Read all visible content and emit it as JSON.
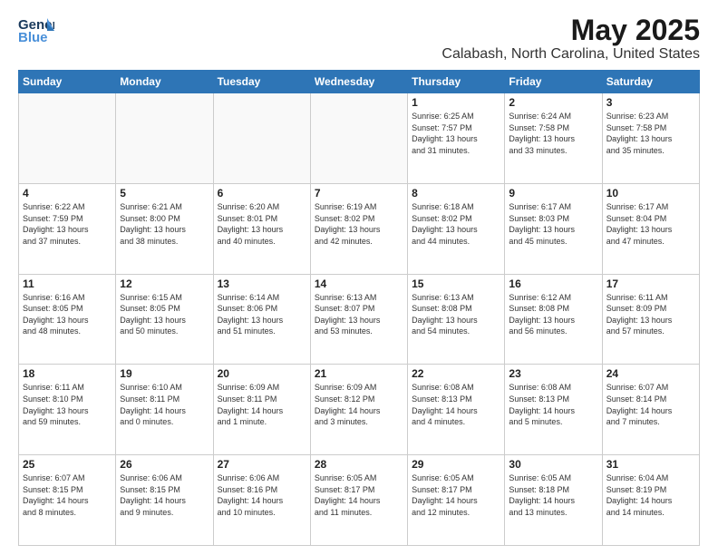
{
  "logo": {
    "line1": "General",
    "line2": "Blue"
  },
  "title": "May 2025",
  "subtitle": "Calabash, North Carolina, United States",
  "weekdays": [
    "Sunday",
    "Monday",
    "Tuesday",
    "Wednesday",
    "Thursday",
    "Friday",
    "Saturday"
  ],
  "weeks": [
    [
      {
        "day": "",
        "info": ""
      },
      {
        "day": "",
        "info": ""
      },
      {
        "day": "",
        "info": ""
      },
      {
        "day": "",
        "info": ""
      },
      {
        "day": "1",
        "info": "Sunrise: 6:25 AM\nSunset: 7:57 PM\nDaylight: 13 hours\nand 31 minutes."
      },
      {
        "day": "2",
        "info": "Sunrise: 6:24 AM\nSunset: 7:58 PM\nDaylight: 13 hours\nand 33 minutes."
      },
      {
        "day": "3",
        "info": "Sunrise: 6:23 AM\nSunset: 7:58 PM\nDaylight: 13 hours\nand 35 minutes."
      }
    ],
    [
      {
        "day": "4",
        "info": "Sunrise: 6:22 AM\nSunset: 7:59 PM\nDaylight: 13 hours\nand 37 minutes."
      },
      {
        "day": "5",
        "info": "Sunrise: 6:21 AM\nSunset: 8:00 PM\nDaylight: 13 hours\nand 38 minutes."
      },
      {
        "day": "6",
        "info": "Sunrise: 6:20 AM\nSunset: 8:01 PM\nDaylight: 13 hours\nand 40 minutes."
      },
      {
        "day": "7",
        "info": "Sunrise: 6:19 AM\nSunset: 8:02 PM\nDaylight: 13 hours\nand 42 minutes."
      },
      {
        "day": "8",
        "info": "Sunrise: 6:18 AM\nSunset: 8:02 PM\nDaylight: 13 hours\nand 44 minutes."
      },
      {
        "day": "9",
        "info": "Sunrise: 6:17 AM\nSunset: 8:03 PM\nDaylight: 13 hours\nand 45 minutes."
      },
      {
        "day": "10",
        "info": "Sunrise: 6:17 AM\nSunset: 8:04 PM\nDaylight: 13 hours\nand 47 minutes."
      }
    ],
    [
      {
        "day": "11",
        "info": "Sunrise: 6:16 AM\nSunset: 8:05 PM\nDaylight: 13 hours\nand 48 minutes."
      },
      {
        "day": "12",
        "info": "Sunrise: 6:15 AM\nSunset: 8:05 PM\nDaylight: 13 hours\nand 50 minutes."
      },
      {
        "day": "13",
        "info": "Sunrise: 6:14 AM\nSunset: 8:06 PM\nDaylight: 13 hours\nand 51 minutes."
      },
      {
        "day": "14",
        "info": "Sunrise: 6:13 AM\nSunset: 8:07 PM\nDaylight: 13 hours\nand 53 minutes."
      },
      {
        "day": "15",
        "info": "Sunrise: 6:13 AM\nSunset: 8:08 PM\nDaylight: 13 hours\nand 54 minutes."
      },
      {
        "day": "16",
        "info": "Sunrise: 6:12 AM\nSunset: 8:08 PM\nDaylight: 13 hours\nand 56 minutes."
      },
      {
        "day": "17",
        "info": "Sunrise: 6:11 AM\nSunset: 8:09 PM\nDaylight: 13 hours\nand 57 minutes."
      }
    ],
    [
      {
        "day": "18",
        "info": "Sunrise: 6:11 AM\nSunset: 8:10 PM\nDaylight: 13 hours\nand 59 minutes."
      },
      {
        "day": "19",
        "info": "Sunrise: 6:10 AM\nSunset: 8:11 PM\nDaylight: 14 hours\nand 0 minutes."
      },
      {
        "day": "20",
        "info": "Sunrise: 6:09 AM\nSunset: 8:11 PM\nDaylight: 14 hours\nand 1 minute."
      },
      {
        "day": "21",
        "info": "Sunrise: 6:09 AM\nSunset: 8:12 PM\nDaylight: 14 hours\nand 3 minutes."
      },
      {
        "day": "22",
        "info": "Sunrise: 6:08 AM\nSunset: 8:13 PM\nDaylight: 14 hours\nand 4 minutes."
      },
      {
        "day": "23",
        "info": "Sunrise: 6:08 AM\nSunset: 8:13 PM\nDaylight: 14 hours\nand 5 minutes."
      },
      {
        "day": "24",
        "info": "Sunrise: 6:07 AM\nSunset: 8:14 PM\nDaylight: 14 hours\nand 7 minutes."
      }
    ],
    [
      {
        "day": "25",
        "info": "Sunrise: 6:07 AM\nSunset: 8:15 PM\nDaylight: 14 hours\nand 8 minutes."
      },
      {
        "day": "26",
        "info": "Sunrise: 6:06 AM\nSunset: 8:15 PM\nDaylight: 14 hours\nand 9 minutes."
      },
      {
        "day": "27",
        "info": "Sunrise: 6:06 AM\nSunset: 8:16 PM\nDaylight: 14 hours\nand 10 minutes."
      },
      {
        "day": "28",
        "info": "Sunrise: 6:05 AM\nSunset: 8:17 PM\nDaylight: 14 hours\nand 11 minutes."
      },
      {
        "day": "29",
        "info": "Sunrise: 6:05 AM\nSunset: 8:17 PM\nDaylight: 14 hours\nand 12 minutes."
      },
      {
        "day": "30",
        "info": "Sunrise: 6:05 AM\nSunset: 8:18 PM\nDaylight: 14 hours\nand 13 minutes."
      },
      {
        "day": "31",
        "info": "Sunrise: 6:04 AM\nSunset: 8:19 PM\nDaylight: 14 hours\nand 14 minutes."
      }
    ]
  ]
}
